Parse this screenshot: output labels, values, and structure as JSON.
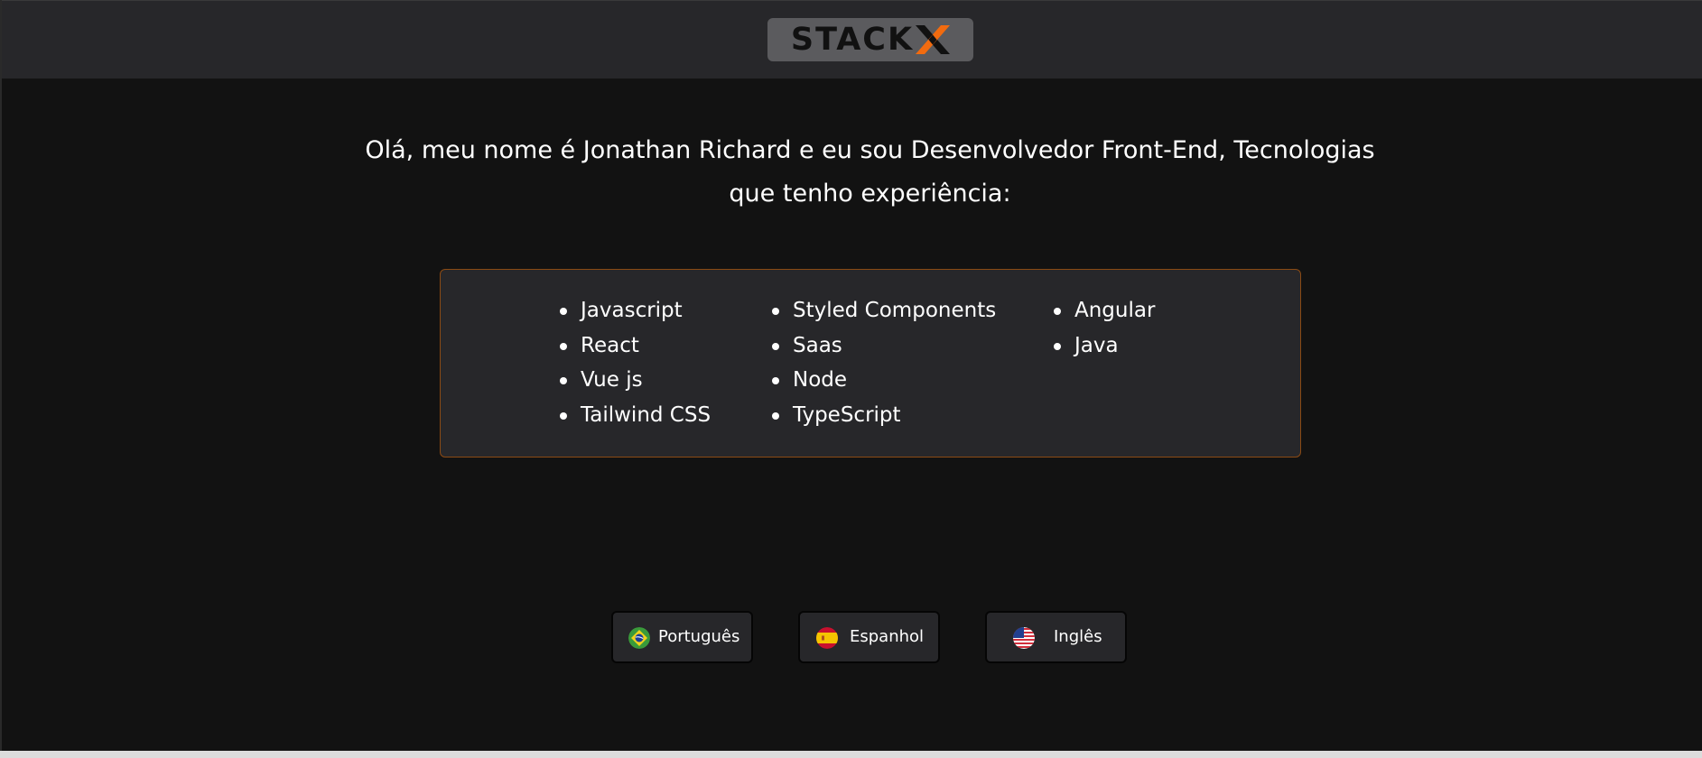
{
  "header": {
    "logo_text": "STACK",
    "logo_mark": "X"
  },
  "intro": {
    "line1": "Olá, meu nome é Jonathan Richard e eu sou Desenvolvedor Front-End, Tecnologias",
    "line2": "que tenho experiência:"
  },
  "technologies": {
    "column1": [
      "Javascript",
      "React",
      "Vue js",
      "Tailwind CSS"
    ],
    "column2": [
      "Styled Components",
      "Saas",
      "Node",
      "TypeScript"
    ],
    "column3": [
      "Angular",
      "Java"
    ]
  },
  "languages": [
    {
      "label": "Português",
      "flag_icon": "brazil-flag-icon"
    },
    {
      "label": "Espanhol",
      "flag_icon": "spain-flag-icon"
    },
    {
      "label": "Inglês",
      "flag_icon": "usa-flag-icon"
    }
  ],
  "colors": {
    "header_bg": "#27272a",
    "page_bg": "#121212",
    "accent": "#f26b0f",
    "box_border": "#8a4a14"
  }
}
